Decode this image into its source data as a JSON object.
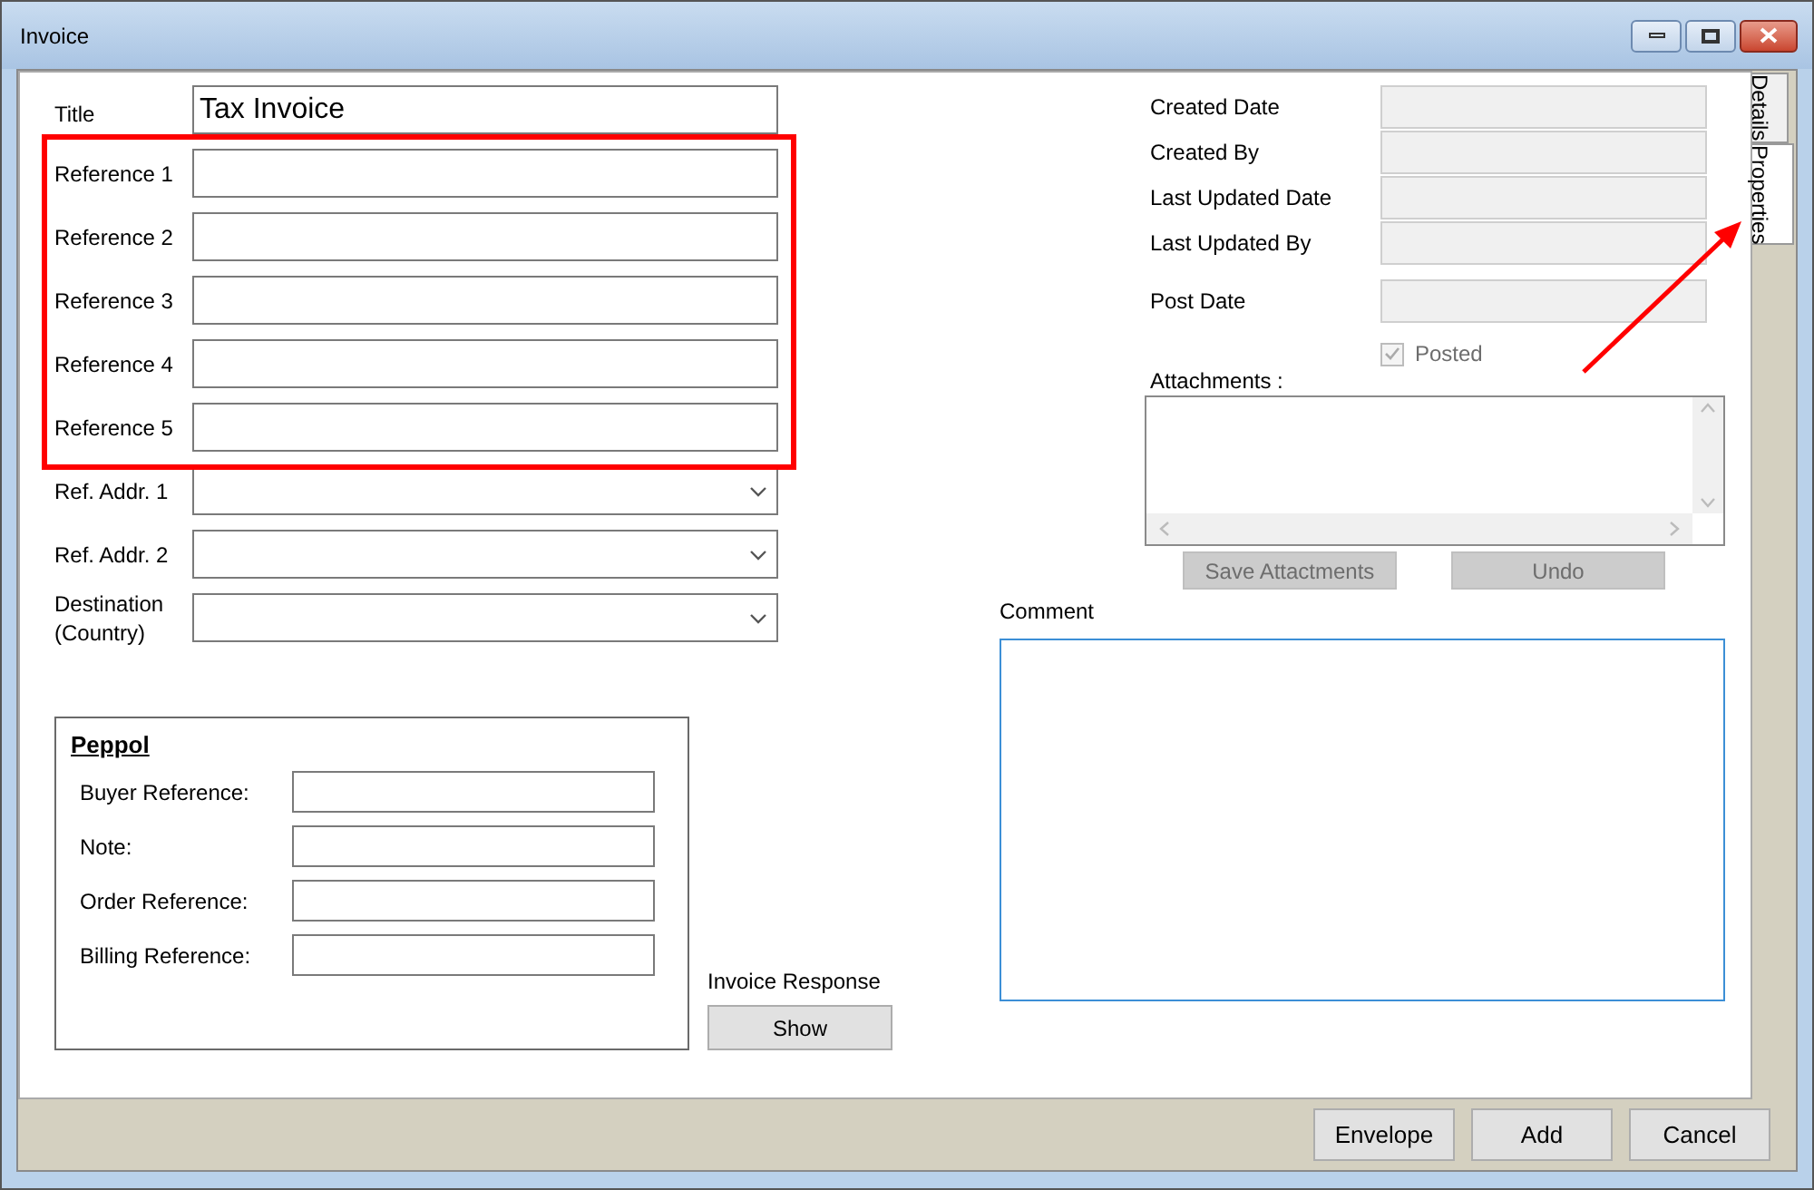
{
  "window": {
    "title": "Invoice"
  },
  "title_field": {
    "label": "Title",
    "value": "Tax Invoice"
  },
  "references": [
    {
      "label": "Reference 1"
    },
    {
      "label": "Reference 2"
    },
    {
      "label": "Reference 3"
    },
    {
      "label": "Reference 4"
    },
    {
      "label": "Reference 5"
    }
  ],
  "address_fields": [
    {
      "label": "Ref. Addr. 1"
    },
    {
      "label": "Ref. Addr. 2"
    },
    {
      "label": "Destination (Country)"
    }
  ],
  "peppol": {
    "title": "Peppol",
    "fields": [
      {
        "label": "Buyer Reference:"
      },
      {
        "label": "Note:"
      },
      {
        "label": "Order Reference:"
      },
      {
        "label": "Billing Reference:"
      }
    ]
  },
  "invoice_response": {
    "label": "Invoice Response",
    "button": "Show"
  },
  "meta_fields": [
    {
      "label": "Created Date",
      "disabled": true
    },
    {
      "label": "Created By",
      "disabled": true
    },
    {
      "label": "Last Updated Date",
      "disabled": true
    },
    {
      "label": "Last Updated By",
      "disabled": true
    },
    {
      "label": "Post Date",
      "disabled": true
    }
  ],
  "posted": {
    "label": "Posted",
    "checked": true,
    "disabled": true
  },
  "attachments": {
    "label": "Attachments :"
  },
  "attachment_buttons": [
    {
      "label": "Save Attactments",
      "disabled": true
    },
    {
      "label": "Undo",
      "disabled": true
    }
  ],
  "comment": {
    "label": "Comment"
  },
  "side_tabs": [
    {
      "label": "Details",
      "selected": false
    },
    {
      "label": "Properties",
      "selected": true
    }
  ],
  "footer_buttons": [
    "Envelope",
    "Add",
    "Cancel"
  ]
}
